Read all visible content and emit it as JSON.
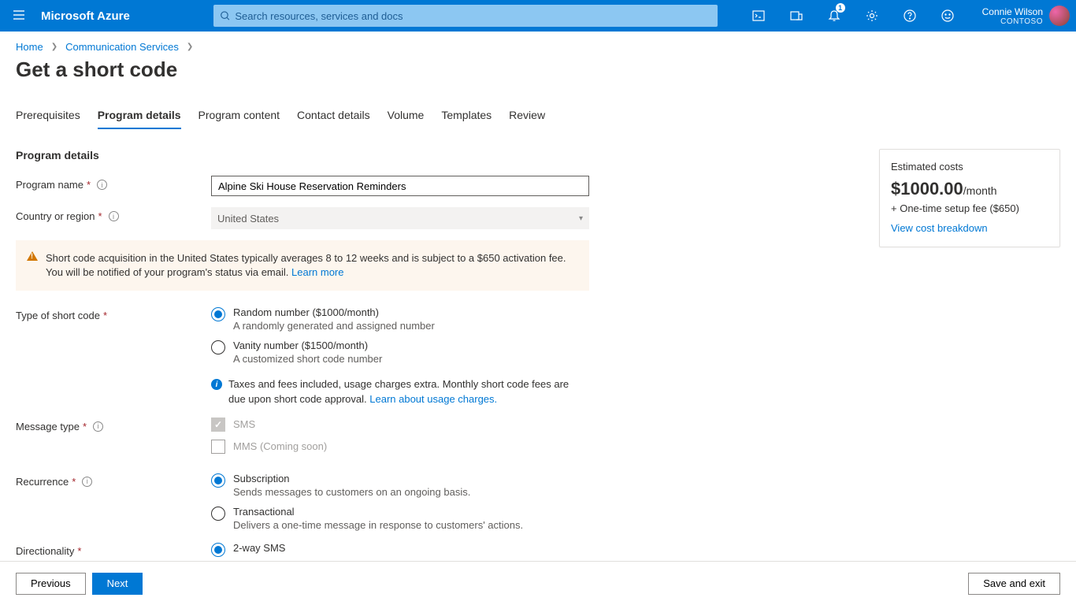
{
  "brand": "Microsoft Azure",
  "search": {
    "placeholder": "Search resources, services and docs"
  },
  "notifications": {
    "count": "1"
  },
  "account": {
    "user": "Connie Wilson",
    "tenant": "CONTOSO"
  },
  "breadcrumb": {
    "home": "Home",
    "cs": "Communication Services"
  },
  "page_title": "Get a short code",
  "tabs": [
    "Prerequisites",
    "Program details",
    "Program content",
    "Contact details",
    "Volume",
    "Templates",
    "Review"
  ],
  "section": "Program details",
  "fields": {
    "program_name_label": "Program name",
    "program_name_value": "Alpine Ski House Reservation Reminders",
    "country_label": "Country or region",
    "country_value": "United States",
    "type_label": "Type of short code",
    "msg_label": "Message type",
    "recurrence_label": "Recurrence",
    "direction_label": "Directionality"
  },
  "warning": {
    "text": "Short code acquisition in the United States typically averages 8 to 12 weeks and is subject to a $650 activation fee. You will be notified of your program's status via email. ",
    "link": "Learn more"
  },
  "type_options": {
    "random": {
      "label": "Random number ($1000/month)",
      "sub": "A randomly generated and assigned number"
    },
    "vanity": {
      "label": "Vanity number ($1500/month)",
      "sub": "A customized short code number"
    }
  },
  "tax_note": {
    "text": "Taxes and fees included, usage charges extra. Monthly short code fees are due upon short code approval. ",
    "link": "Learn about usage charges."
  },
  "msg": {
    "sms": "SMS",
    "mms": "MMS (Coming soon)"
  },
  "recurrence": {
    "sub": {
      "label": "Subscription",
      "sub": "Sends messages to customers on an ongoing basis."
    },
    "trans": {
      "label": "Transactional",
      "sub": "Delivers a one-time message in response to customers' actions."
    }
  },
  "direction": {
    "twoway": "2-way SMS"
  },
  "cost": {
    "title": "Estimated costs",
    "amount": "$1000.00",
    "unit": "/month",
    "fee": "+ One-time setup fee ($650)",
    "link": "View cost breakdown"
  },
  "footer": {
    "prev": "Previous",
    "next": "Next",
    "save": "Save and exit"
  }
}
